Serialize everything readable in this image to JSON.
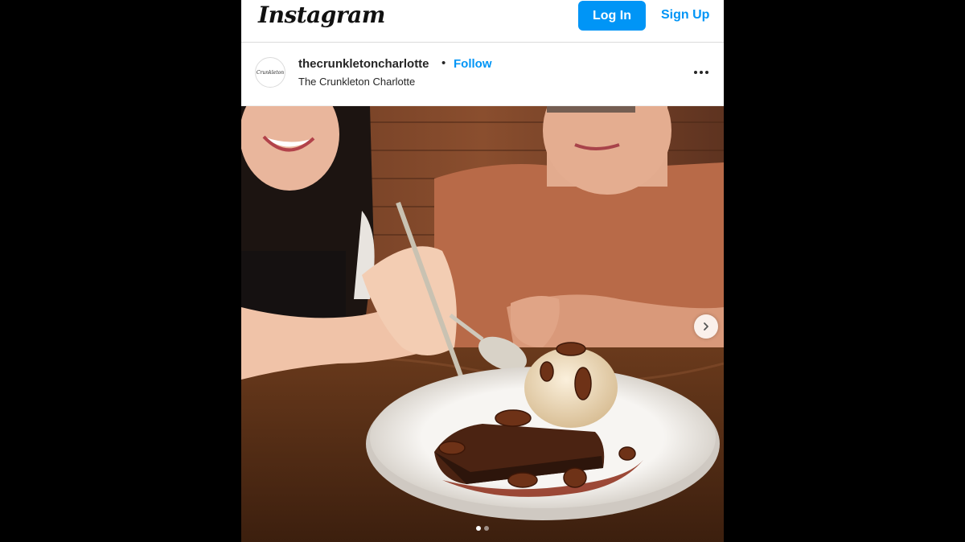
{
  "header": {
    "logo_text": "Instagram",
    "login_label": "Log In",
    "signup_label": "Sign Up"
  },
  "post": {
    "avatar_text": "Crunkleton",
    "username": "thecrunkletoncharlotte",
    "separator": "•",
    "follow_label": "Follow",
    "location": "The Crunkleton Charlotte",
    "more_icon": "more-options-icon",
    "carousel": {
      "current_index": 1,
      "total": 2,
      "next_icon": "chevron-right-icon"
    }
  },
  "colors": {
    "brand_blue": "#0095f6",
    "background": "#000000"
  }
}
